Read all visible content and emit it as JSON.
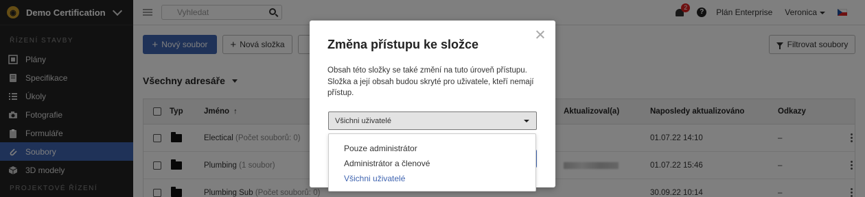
{
  "sidebar": {
    "app_title": "Demo Certification",
    "section_label": "ŘÍZENÍ STAVBY",
    "items": [
      {
        "label": "Plány",
        "icon": "blueprint-icon"
      },
      {
        "label": "Specifikace",
        "icon": "spec-book-icon"
      },
      {
        "label": "Úkoly",
        "icon": "task-list-icon"
      },
      {
        "label": "Fotografie",
        "icon": "camera-icon"
      },
      {
        "label": "Formuláře",
        "icon": "clipboard-icon"
      },
      {
        "label": "Soubory",
        "icon": "paperclip-icon"
      },
      {
        "label": "3D modely",
        "icon": "cube-icon"
      }
    ],
    "active_index": 5,
    "section2_label": "PROJEKTOVÉ ŘÍZENÍ"
  },
  "topbar": {
    "search_placeholder": "Vyhledat",
    "notification_count": "2",
    "help_label": "?",
    "plan_label": "Plán Enterprise",
    "user_label": "Veronica"
  },
  "toolbar": {
    "new_file_label": "Nový soubor",
    "new_folder_label": "Nová složka",
    "filter_label": "Filtrovat soubory"
  },
  "directory_label": "Všechny adresáře",
  "table": {
    "headers": {
      "type": "Typ",
      "name": "Jméno",
      "updated_by": "Aktualizoval(a)",
      "last_updated": "Naposledy aktualizováno",
      "links": "Odkazy"
    },
    "rows": [
      {
        "name": "Electical",
        "meta": "(Počet souborů: 0)",
        "date": "01.07.22 14:10",
        "links": "–",
        "updated_by_visible": false
      },
      {
        "name": "Plumbing",
        "meta": "(1 soubor)",
        "date": "01.07.22 15:46",
        "links": "–",
        "updated_by_visible": true
      },
      {
        "name": "Plumbing Sub",
        "meta": "(Počet souborů: 0)",
        "date": "30.09.22 10:14",
        "links": "–",
        "updated_by_visible": false
      }
    ]
  },
  "modal": {
    "title": "Změna přístupu ke složce",
    "description": "Obsah této složky se také změní na tuto úroveň přístupu. Složka a její obsah budou skryté pro uživatele, kteří nemají přístup.",
    "select_value": "Všichni uživatelé",
    "options": [
      "Pouze administrátor",
      "Administrátor a členové",
      "Všichni uživatelé"
    ],
    "selected_index": 2
  },
  "colors": {
    "accent": "#3f64b0",
    "sidebar_bg": "#222222",
    "badge": "#dd2222"
  }
}
